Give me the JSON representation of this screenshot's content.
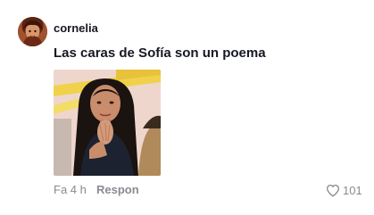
{
  "comment": {
    "username": "cornelia",
    "text": "Las caras de Sofía son un poema",
    "timestamp": "Fa 4 h",
    "reply_label": "Respon",
    "like_count": "101",
    "avatar_icon": "user-avatar",
    "like_icon": "heart-outline-icon"
  },
  "colors": {
    "text_primary": "#161823",
    "text_secondary": "#8a8b91"
  }
}
